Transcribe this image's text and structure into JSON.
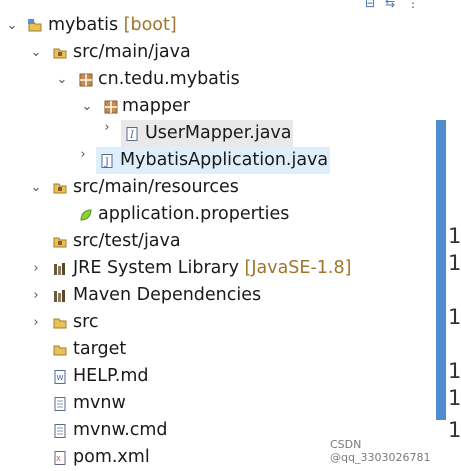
{
  "tree": {
    "items": [
      {
        "label": "mybatis",
        "decoration": " [boot]"
      },
      {
        "label": "src/main/java"
      },
      {
        "label": "cn.tedu.mybatis"
      },
      {
        "label": "mapper"
      },
      {
        "label": "UserMapper.java"
      },
      {
        "label": "MybatisApplication.java"
      },
      {
        "label": "src/main/resources"
      },
      {
        "label": "application.properties"
      },
      {
        "label": "src/test/java"
      },
      {
        "label": "JRE System Library",
        "decoration": " [JavaSE-1.8]"
      },
      {
        "label": "Maven Dependencies"
      },
      {
        "label": "src"
      },
      {
        "label": "target"
      },
      {
        "label": "HELP.md"
      },
      {
        "label": "mvnw"
      },
      {
        "label": "mvnw.cmd"
      },
      {
        "label": "pom.xml"
      }
    ]
  },
  "ruler": {
    "line_numbers": [
      "1",
      "1",
      "1",
      "1",
      "1",
      "1"
    ]
  },
  "watermark": "CSDN @qq_3303026781",
  "colors": {
    "accent": "#4e8ccd",
    "decoration": "#a0752b",
    "selection_current": "#e9e9e9",
    "selection_other": "#dfeefb"
  },
  "icons": [
    "collapse-all-icon",
    "link-with-editor-icon",
    "view-menu-icon",
    "project-icon",
    "source-folder-icon",
    "package-icon",
    "interface-file-icon",
    "java-file-icon",
    "properties-file-icon",
    "library-icon",
    "folder-icon",
    "markdown-file-icon",
    "text-file-icon",
    "xml-file-icon"
  ]
}
